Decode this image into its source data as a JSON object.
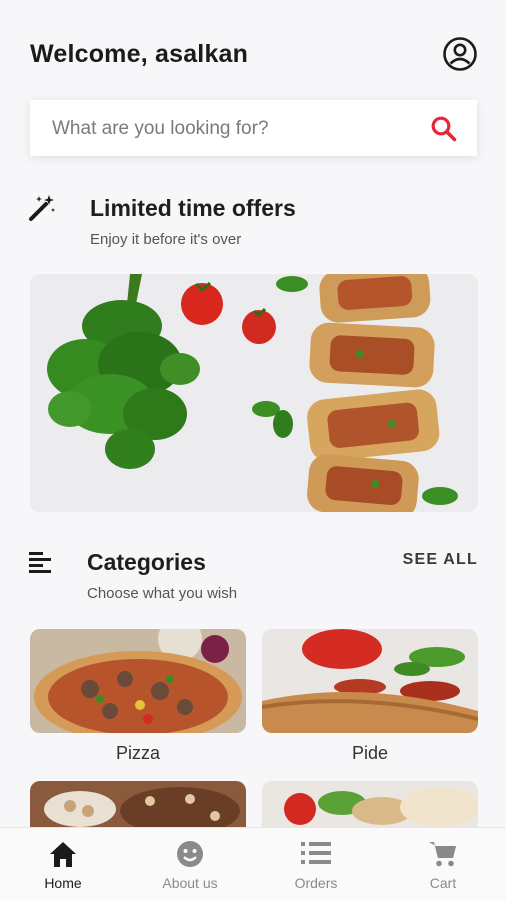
{
  "header": {
    "welcome": "Welcome, asalkan"
  },
  "search": {
    "placeholder": "What are you looking for?"
  },
  "offers": {
    "title": "Limited time offers",
    "subtitle": "Enjoy it before it's over"
  },
  "categories": {
    "title": "Categories",
    "subtitle": "Choose what you wish",
    "see_all": "SEE ALL",
    "items": [
      {
        "label": "Pizza"
      },
      {
        "label": "Pide"
      },
      {
        "label": ""
      },
      {
        "label": ""
      }
    ]
  },
  "nav": {
    "items": [
      {
        "label": "Home",
        "icon": "home-icon",
        "active": true
      },
      {
        "label": "About us",
        "icon": "smiley-icon",
        "active": false
      },
      {
        "label": "Orders",
        "icon": "list-icon",
        "active": false
      },
      {
        "label": "Cart",
        "icon": "cart-icon",
        "active": false
      }
    ]
  },
  "colors": {
    "accent": "#e8263a",
    "background": "#f7f7f9"
  }
}
